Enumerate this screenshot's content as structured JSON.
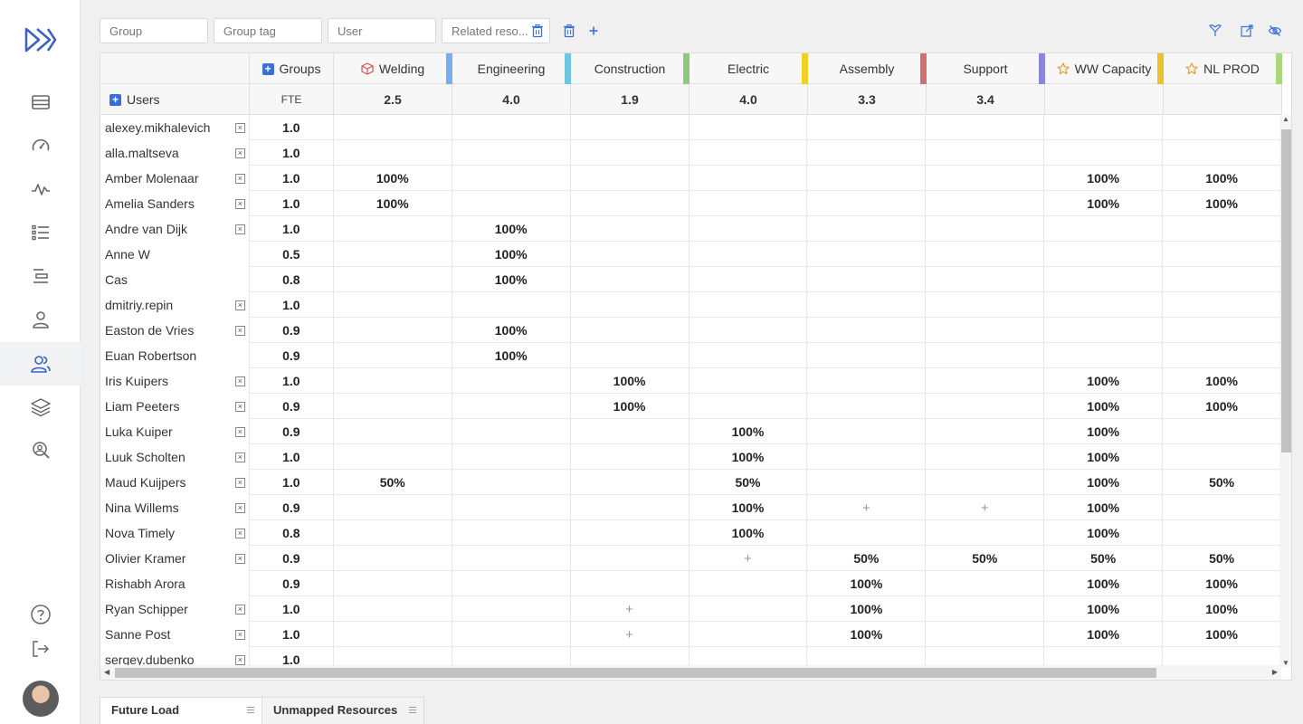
{
  "filters": {
    "group_placeholder": "Group",
    "group_tag_placeholder": "Group tag",
    "user_placeholder": "User",
    "related_placeholder": "Related reso..."
  },
  "header": {
    "groups_label": "Groups",
    "users_label": "Users",
    "fte_label": "FTE",
    "columns": [
      {
        "label": "Welding",
        "total": "2.5",
        "icon": "cube-icon",
        "stripe": "#78aef0"
      },
      {
        "label": "Engineering",
        "total": "4.0",
        "icon": "",
        "stripe": "#6ec6e0"
      },
      {
        "label": "Construction",
        "total": "1.9",
        "icon": "",
        "stripe": "#8cc97a"
      },
      {
        "label": "Electric",
        "total": "4.0",
        "icon": "",
        "stripe": "#f0d020"
      },
      {
        "label": "Assembly",
        "total": "3.3",
        "icon": "",
        "stripe": "#d36f6f"
      },
      {
        "label": "Support",
        "total": "3.4",
        "icon": "",
        "stripe": "#8a86dc"
      },
      {
        "label": "WW Capacity",
        "total": "",
        "icon": "star-icon",
        "stripe": "#f0c02c"
      },
      {
        "label": "NL PROD",
        "total": "",
        "icon": "star-icon",
        "stripe": "#a8d87a"
      }
    ]
  },
  "rows": [
    {
      "name": "alexey.mikhalevich",
      "x": true,
      "fte": "1.0",
      "cells": [
        "",
        "",
        "",
        "",
        "",
        "",
        "",
        ""
      ]
    },
    {
      "name": "alla.maltseva",
      "x": true,
      "fte": "1.0",
      "cells": [
        "",
        "",
        "",
        "",
        "",
        "",
        "",
        ""
      ]
    },
    {
      "name": "Amber Molenaar",
      "x": true,
      "fte": "1.0",
      "cells": [
        "100%",
        "",
        "",
        "",
        "",
        "",
        "100%",
        "100%"
      ]
    },
    {
      "name": "Amelia Sanders",
      "x": true,
      "fte": "1.0",
      "cells": [
        "100%",
        "",
        "",
        "",
        "",
        "",
        "100%",
        "100%"
      ]
    },
    {
      "name": "Andre van Dijk",
      "x": true,
      "fte": "1.0",
      "cells": [
        "",
        "100%",
        "",
        "",
        "",
        "",
        "",
        ""
      ]
    },
    {
      "name": "Anne W",
      "x": false,
      "fte": "0.5",
      "cells": [
        "",
        "100%",
        "",
        "",
        "",
        "",
        "",
        ""
      ]
    },
    {
      "name": "Cas",
      "x": false,
      "fte": "0.8",
      "cells": [
        "",
        "100%",
        "",
        "",
        "",
        "",
        "",
        ""
      ]
    },
    {
      "name": "dmitriy.repin",
      "x": true,
      "fte": "1.0",
      "cells": [
        "",
        "",
        "",
        "",
        "",
        "",
        "",
        ""
      ]
    },
    {
      "name": "Easton de Vries",
      "x": true,
      "fte": "0.9",
      "cells": [
        "",
        "100%",
        "",
        "",
        "",
        "",
        "",
        ""
      ]
    },
    {
      "name": "Euan Robertson",
      "x": false,
      "fte": "0.9",
      "cells": [
        "",
        "100%",
        "",
        "",
        "",
        "",
        "",
        ""
      ]
    },
    {
      "name": "Iris Kuipers",
      "x": true,
      "fte": "1.0",
      "cells": [
        "",
        "",
        "100%",
        "",
        "",
        "",
        "100%",
        "100%"
      ]
    },
    {
      "name": "Liam Peeters",
      "x": true,
      "fte": "0.9",
      "cells": [
        "",
        "",
        "100%",
        "",
        "",
        "",
        "100%",
        "100%"
      ]
    },
    {
      "name": "Luka Kuiper",
      "x": true,
      "fte": "0.9",
      "cells": [
        "",
        "",
        "",
        "100%",
        "",
        "",
        "100%",
        ""
      ]
    },
    {
      "name": "Luuk Scholten",
      "x": true,
      "fte": "1.0",
      "cells": [
        "",
        "",
        "",
        "100%",
        "",
        "",
        "100%",
        ""
      ]
    },
    {
      "name": "Maud Kuijpers",
      "x": true,
      "fte": "1.0",
      "cells": [
        "50%",
        "",
        "",
        "50%",
        "",
        "",
        "100%",
        "50%"
      ]
    },
    {
      "name": "Nina Willems",
      "x": true,
      "fte": "0.9",
      "cells": [
        "",
        "",
        "",
        "100%",
        "+",
        "+",
        "100%",
        ""
      ]
    },
    {
      "name": "Nova Timely",
      "x": true,
      "fte": "0.8",
      "cells": [
        "",
        "",
        "",
        "100%",
        "",
        "",
        "100%",
        ""
      ]
    },
    {
      "name": "Olivier Kramer",
      "x": true,
      "fte": "0.9",
      "cells": [
        "",
        "",
        "",
        "+",
        "50%",
        "50%",
        "50%",
        "50%"
      ]
    },
    {
      "name": "Rishabh Arora",
      "x": false,
      "fte": "0.9",
      "cells": [
        "",
        "",
        "",
        "",
        "100%",
        "",
        "100%",
        "100%"
      ]
    },
    {
      "name": "Ryan Schipper",
      "x": true,
      "fte": "1.0",
      "cells": [
        "",
        "",
        "+",
        "",
        "100%",
        "",
        "100%",
        "100%"
      ]
    },
    {
      "name": "Sanne Post",
      "x": true,
      "fte": "1.0",
      "cells": [
        "",
        "",
        "+",
        "",
        "100%",
        "",
        "100%",
        "100%"
      ]
    },
    {
      "name": "sergey.dubenko",
      "x": true,
      "fte": "1.0",
      "cells": [
        "",
        "",
        "",
        "",
        "",
        "",
        "",
        ""
      ]
    }
  ],
  "tabs": [
    {
      "label": "Future Load"
    },
    {
      "label": "Unmapped Resources"
    }
  ],
  "colors": {
    "accent": "#3a6fd8",
    "sidebar_icon": "#666666"
  },
  "icons": {
    "sidebar": [
      "list-icon",
      "speedometer-icon",
      "activity-icon",
      "bullet-list-icon",
      "gantt-icon",
      "user-icon",
      "users-icon",
      "layers-icon",
      "search-users-icon"
    ],
    "sidebar_bottom": [
      "help-icon",
      "logout-icon"
    ],
    "toolbar": [
      "trash-icon",
      "trash-icon",
      "plus-icon",
      "filter-heart-icon",
      "external-link-icon",
      "eye-off-icon"
    ]
  }
}
